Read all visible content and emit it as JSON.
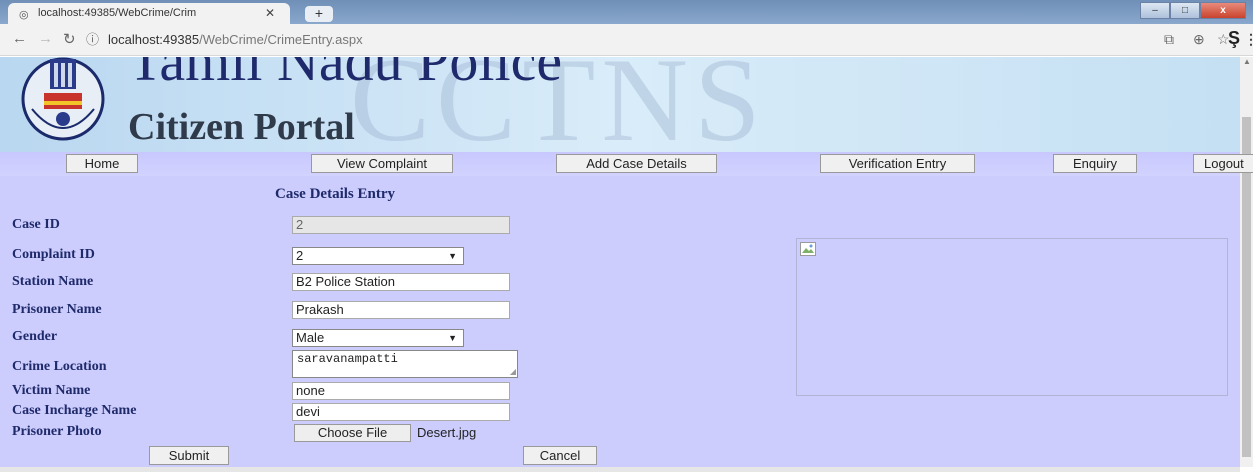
{
  "browser": {
    "tab_title": "localhost:49385/WebCrime/Crim",
    "new_tab": "+",
    "url_host": "localhost:49385",
    "url_path": "/WebCrime/CrimeEntry.aspx",
    "window_buttons": {
      "minimize": "–",
      "maximize": "□",
      "close": "x"
    }
  },
  "banner": {
    "title": "Tamil Nadu Police",
    "subtitle": "Citizen Portal",
    "watermark": "CCTNS"
  },
  "menu": [
    {
      "label": "Home"
    },
    {
      "label": "View Complaint"
    },
    {
      "label": "Add Case Details"
    },
    {
      "label": "Verification Entry"
    },
    {
      "label": "Enquiry"
    },
    {
      "label": "Logout"
    }
  ],
  "form": {
    "heading": "Case Details Entry",
    "case_id": {
      "label": "Case ID",
      "value": "2"
    },
    "complaint_id": {
      "label": "Complaint ID",
      "value": "2"
    },
    "station_name": {
      "label": "Station Name",
      "value": "B2 Police Station"
    },
    "prisoner_name": {
      "label": "Prisoner Name",
      "value": "Prakash"
    },
    "gender": {
      "label": "Gender",
      "value": "Male"
    },
    "crime_location": {
      "label": "Crime Location",
      "value": "saravanampatti"
    },
    "victim_name": {
      "label": "Victim Name",
      "value": "none"
    },
    "case_incharge": {
      "label": "Case Incharge Name",
      "value": "devi"
    },
    "prisoner_photo": {
      "label": "Prisoner Photo",
      "button": "Choose File",
      "file": "Desert.jpg"
    },
    "submit": "Submit",
    "cancel": "Cancel"
  }
}
